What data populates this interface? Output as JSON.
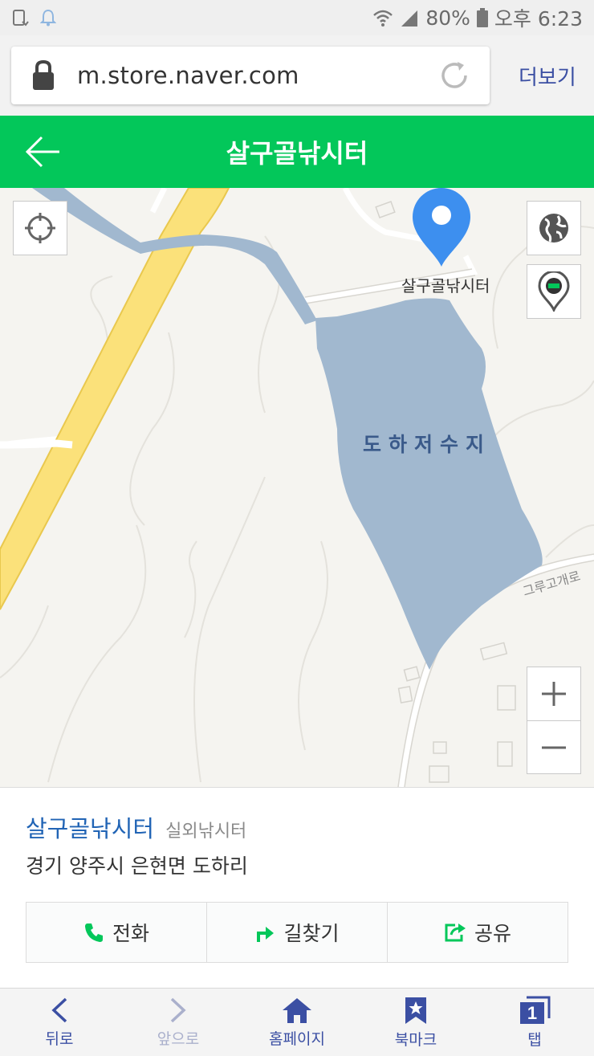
{
  "status_bar": {
    "battery": "80%",
    "time": "오후 6:23",
    "icons": [
      "screen-rotate-icon",
      "notification-bell-icon",
      "wifi-icon",
      "signal-icon",
      "battery-icon"
    ]
  },
  "browser": {
    "url": "m.store.naver.com",
    "more_label": "더보기"
  },
  "header": {
    "title": "살구골낚시터",
    "color": "#03c75a"
  },
  "map": {
    "marker_label": "살구골낚시터",
    "lake_label": "도하저수지",
    "road_label": "그루고개로",
    "zoom_in": "+",
    "zoom_out": "−"
  },
  "place": {
    "name": "살구골낚시터",
    "category": "실외낚시터",
    "address": "경기 양주시 은현면 도하리",
    "actions": [
      {
        "label": "전화",
        "icon": "phone-icon"
      },
      {
        "label": "길찾기",
        "icon": "directions-icon"
      },
      {
        "label": "공유",
        "icon": "share-icon"
      }
    ]
  },
  "bottom_nav": [
    {
      "label": "뒤로",
      "icon": "back-chevron-icon"
    },
    {
      "label": "앞으로",
      "icon": "forward-chevron-icon"
    },
    {
      "label": "홈페이지",
      "icon": "home-icon"
    },
    {
      "label": "북마크",
      "icon": "bookmark-icon"
    },
    {
      "label": "탭",
      "icon": "tabs-icon",
      "count": "1"
    }
  ]
}
